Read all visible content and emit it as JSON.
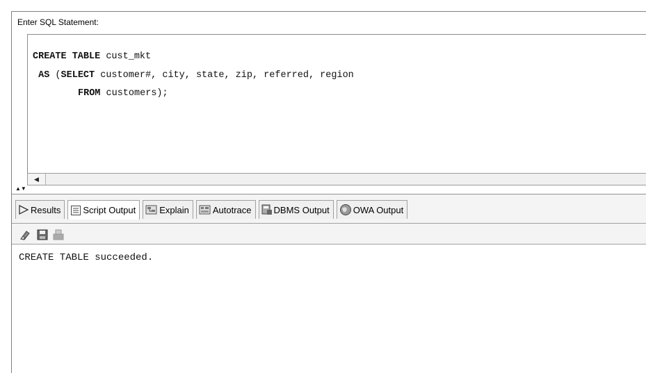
{
  "editor": {
    "label": "Enter SQL Statement:",
    "lines": [
      {
        "kw": "CREATE TABLE",
        "rest": " cust_mkt"
      },
      {
        "kw": "AS",
        "pre": " (",
        "kw2": "SELECT",
        "rest": " customer#, city, state, zip, referred, region",
        "lead": " "
      },
      {
        "kw": "FROM",
        "rest": " customers);"
      }
    ]
  },
  "tabs": [
    {
      "label": "Results",
      "icon": "results-arrow-icon",
      "active": false
    },
    {
      "label": "Script Output",
      "icon": "script-output-icon",
      "active": true
    },
    {
      "label": "Explain",
      "icon": "explain-icon",
      "active": false
    },
    {
      "label": "Autotrace",
      "icon": "autotrace-icon",
      "active": false
    },
    {
      "label": "DBMS Output",
      "icon": "dbms-output-icon",
      "active": false
    },
    {
      "label": "OWA Output",
      "icon": "owa-output-icon",
      "active": false
    }
  ],
  "toolbar": {
    "icons": [
      "eraser-icon",
      "save-icon",
      "print-icon"
    ]
  },
  "output": {
    "text": "CREATE TABLE succeeded."
  }
}
